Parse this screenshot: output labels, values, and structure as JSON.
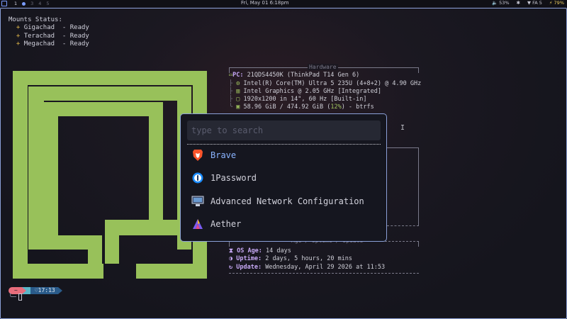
{
  "topbar": {
    "workspaces": [
      "1",
      "2",
      "3",
      "4",
      "5"
    ],
    "clock": "Fri, May 01 6:18pm",
    "status": [
      {
        "icon": "volume-icon",
        "text": "53%"
      },
      {
        "icon": "bluetooth-icon",
        "text": "·"
      },
      {
        "icon": "wifi-icon",
        "text": "FA 5"
      },
      {
        "icon": "battery-icon",
        "text": "79%"
      }
    ]
  },
  "mounts": {
    "title": "Mounts Status:",
    "items": [
      {
        "bullet": "+",
        "name": "Gigachad ",
        "status": "- Ready"
      },
      {
        "bullet": "+",
        "name": "Terachad ",
        "status": "- Ready"
      },
      {
        "bullet": "+",
        "name": "Megachad ",
        "status": "- Ready"
      }
    ]
  },
  "hardware": {
    "header": "Hardware",
    "pc_label": "PC:",
    "pc_value": "21QDS4450K (ThinkPad T14 Gen 6)",
    "cpu": "Intel(R) Core(TM) Ultra 5 235U (4+8+2) @ 4.90 GHz",
    "gpu": "Intel Graphics @ 2.05 GHz [Integrated]",
    "display": "1920x1200 in 14\", 60 Hz [Built-in]",
    "disk_used": "58.96 GiB / 474.92 GiB (",
    "disk_pct": "12%",
    "disk_fs": ") - btrfs"
  },
  "age": {
    "header": "Age / Uptime / Update",
    "os_age_label": "OS Age:",
    "os_age": "14 days",
    "uptime_label": "Uptime:",
    "uptime": "2 days, 5 hours, 20 mins",
    "update_label": "Update:",
    "update": "Wednesday, April 29 2026 at 11:53"
  },
  "prompt": {
    "segment_a": "~",
    "time": "17:13",
    "line2": "╰─"
  },
  "launcher": {
    "placeholder": "type to search",
    "items": [
      {
        "name": "Brave",
        "icon": "brave-icon",
        "selected": true
      },
      {
        "name": "1Password",
        "icon": "1password-icon",
        "selected": false
      },
      {
        "name": "Advanced Network Configuration",
        "icon": "network-config-icon",
        "selected": false
      },
      {
        "name": "Aether",
        "icon": "aether-icon",
        "selected": false
      }
    ]
  }
}
